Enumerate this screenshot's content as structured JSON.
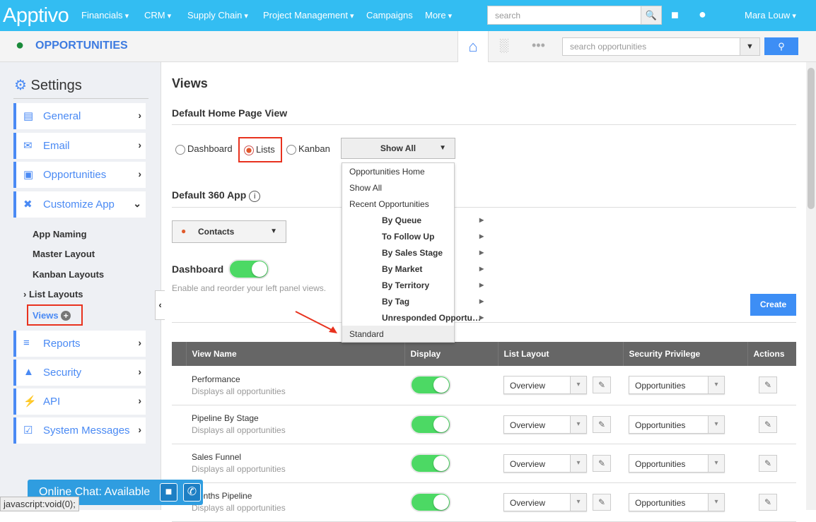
{
  "topbar": {
    "logo": "Apptivo",
    "nav": [
      "Financials",
      "CRM",
      "Supply Chain",
      "Project Management",
      "Campaigns",
      "More"
    ],
    "search_placeholder": "search",
    "user": "Mara Louw"
  },
  "appbar": {
    "title": "OPPORTUNITIES",
    "search_placeholder": "search opportunities"
  },
  "sidebar": {
    "title": "Settings",
    "items": [
      {
        "label": "General",
        "icon": "monitor-icon"
      },
      {
        "label": "Email",
        "icon": "envelope-icon"
      },
      {
        "label": "Opportunities",
        "icon": "window-icon"
      },
      {
        "label": "Customize App",
        "icon": "tools-icon"
      },
      {
        "label": "Reports",
        "icon": "report-icon"
      },
      {
        "label": "Security",
        "icon": "lock-icon"
      },
      {
        "label": "API",
        "icon": "plug-icon"
      },
      {
        "label": "System Messages",
        "icon": "message-icon"
      }
    ],
    "sub_items": [
      "App Naming",
      "Master Layout",
      "Kanban Layouts",
      "List Layouts",
      "Views"
    ]
  },
  "main": {
    "title": "Views",
    "default_home": "Default Home Page View",
    "radios": [
      {
        "label": "Dashboard",
        "checked": false
      },
      {
        "label": "Lists",
        "checked": true
      },
      {
        "label": "Kanban",
        "checked": false
      }
    ],
    "view_select": "Show All",
    "menu": [
      "Opportunities Home",
      "Show All",
      "Recent Opportunities",
      "By Queue",
      "To Follow Up",
      "By Sales Stage",
      "By Market",
      "By Territory",
      "By Tag",
      "Unresponded Opportu…",
      "Standard"
    ],
    "default_360": "Default 360 App",
    "app_select": "Contacts",
    "dashboard_label": "Dashboard",
    "dashboard_on": true,
    "dashboard_hint": "Enable and reorder your left panel views.",
    "create": "Create",
    "columns": [
      "View Name",
      "Display",
      "List Layout",
      "Security Privilege",
      "Actions"
    ],
    "rows": [
      {
        "name": "Performance",
        "desc": "Displays all opportunities",
        "layout": "Overview",
        "privilege": "Opportunities",
        "display": true
      },
      {
        "name": "Pipeline By Stage",
        "desc": "Displays all opportunities",
        "layout": "Overview",
        "privilege": "Opportunities",
        "display": true
      },
      {
        "name": "Sales Funnel",
        "desc": "Displays all opportunities",
        "layout": "Overview",
        "privilege": "Opportunities",
        "display": true
      },
      {
        "name": "Months Pipeline",
        "desc": "Displays all opportunities",
        "layout": "Overview",
        "privilege": "Opportunities",
        "display": true
      }
    ]
  },
  "chat": {
    "label": "Online Chat: Available"
  },
  "status": "javascript:void(0);",
  "colors": {
    "topbar": "#33bdf2",
    "accent": "#4a8af4",
    "toggle": "#4cd964",
    "highlight": "#e8321e"
  }
}
